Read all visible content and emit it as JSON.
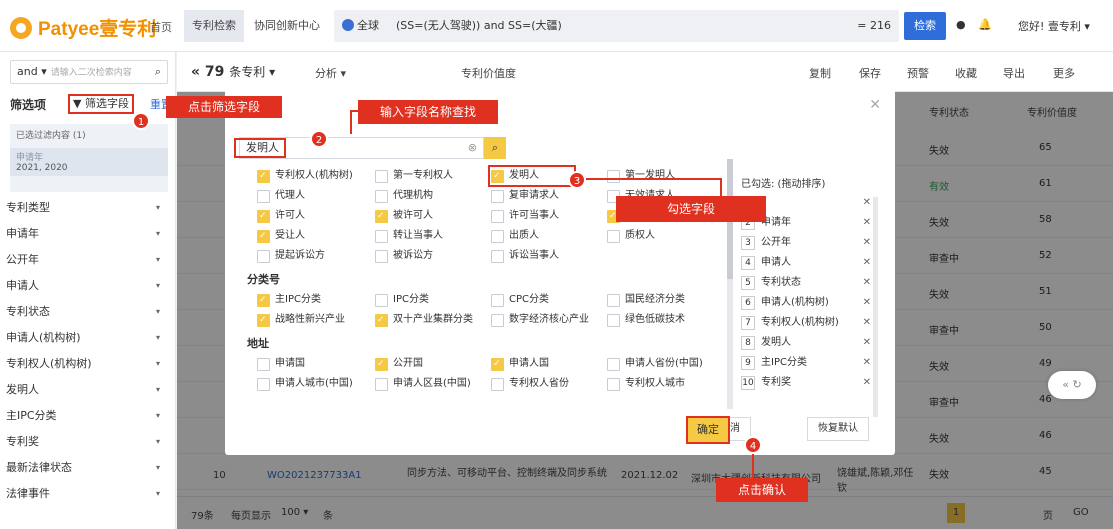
{
  "header": {
    "logo": "Patyee壹专利",
    "home": "首页",
    "tabs": [
      "专利检索",
      "协同创新中心"
    ],
    "scope": "全球",
    "query": "(SS=(无人驾驶)) and SS=(大疆)",
    "count": "= 216",
    "search_btn": "检索",
    "user": "您好! 壹专利 ▾"
  },
  "left": {
    "mode": "and ▾",
    "placeholder": "请输入二次检索内容",
    "filter_title": "筛选项",
    "filter_btn": "筛选字段",
    "reset": "重置",
    "selected_title": "已选过滤内容 (1)",
    "tag_label": "申请年",
    "tag_value": "2021, 2020",
    "items": [
      "专利类型",
      "申请年",
      "公开年",
      "申请人",
      "专利状态",
      "申请人(机构树)",
      "专利权人(机构树)",
      "发明人",
      "主IPC分类",
      "专利奖",
      "最新法律状态",
      "法律事件"
    ]
  },
  "mainbar": {
    "count": "79",
    "unit": "条专利 ▾",
    "analysis": "分析 ▾",
    "value_sort": "专利价值度",
    "actions": [
      "复制",
      "保存",
      "预警",
      "收藏",
      "导出",
      "更多"
    ]
  },
  "dialog": {
    "search_value": "发明人",
    "groups": [
      {
        "title": "",
        "items": [
          [
            "专利权人(机构树)",
            true
          ],
          [
            "第一专利权人",
            false
          ],
          [
            "发明人",
            true
          ],
          [
            "第一发明人",
            false
          ],
          [
            "代理人",
            false
          ],
          [
            "代理机构",
            false
          ],
          [
            "复审请求人",
            false
          ],
          [
            "无效请求人",
            false
          ],
          [
            "许可人",
            true
          ],
          [
            "被许可人",
            true
          ],
          [
            "许可当事人",
            false
          ],
          [
            "",
            true
          ],
          [
            "受让人",
            true
          ],
          [
            "转让当事人",
            false
          ],
          [
            "出质人",
            false
          ],
          [
            "质权人",
            false
          ],
          [
            "提起诉讼方",
            false
          ],
          [
            "被诉讼方",
            false
          ],
          [
            "诉讼当事人",
            false
          ]
        ]
      },
      {
        "title": "分类号",
        "items": [
          [
            "主IPC分类",
            true
          ],
          [
            "IPC分类",
            false
          ],
          [
            "CPC分类",
            false
          ],
          [
            "国民经济分类",
            false
          ],
          [
            "战略性新兴产业",
            true
          ],
          [
            "双十产业集群分类",
            true
          ],
          [
            "数字经济核心产业",
            false
          ],
          [
            "绿色低碳技术",
            false
          ]
        ]
      },
      {
        "title": "地址",
        "items": [
          [
            "申请国",
            false
          ],
          [
            "公开国",
            true
          ],
          [
            "申请人国",
            true
          ],
          [
            "申请人省份(中国)",
            false
          ],
          [
            "申请人城市(中国)",
            false
          ],
          [
            "申请人区县(中国)",
            false
          ],
          [
            "专利权人省份",
            false
          ],
          [
            "专利权人城市",
            false
          ]
        ]
      }
    ],
    "selected_title": "已勾选: (拖动排序)",
    "selected": [
      "",
      "申请年",
      "公开年",
      "申请人",
      "专利状态",
      "申请人(机构树)",
      "专利权人(机构树)",
      "发明人",
      "主IPC分类",
      "专利奖"
    ],
    "btn_ok": "确定",
    "btn_cancel": "取消",
    "btn_reset": "恢复默认"
  },
  "callouts": {
    "c1": "点击筛选字段",
    "c2": "输入字段名称查找",
    "c3": "勾选字段",
    "c4": "点击确认"
  },
  "table": {
    "col_status": "专利状态",
    "col_value": "专利价值度",
    "rows": [
      [
        "失效",
        "65"
      ],
      [
        "有效",
        "61"
      ],
      [
        "失效",
        "58"
      ],
      [
        "审查中",
        "52"
      ],
      [
        "失效",
        "51"
      ],
      [
        "审查中",
        "50"
      ],
      [
        "失效",
        "49"
      ],
      [
        "审查中",
        "46"
      ],
      [
        "失效",
        "46"
      ],
      [
        "失效",
        "45"
      ]
    ],
    "row10": {
      "idx": "10",
      "pn": "WO2021237733A1",
      "title": "同步方法、可移动平台、控制终端及同步系统",
      "date": "2021.12.02",
      "applicant": "深圳市大疆创新科技有限公司",
      "inventor": "饶雄斌,陈颖,邓任钦"
    }
  },
  "footer": {
    "total": "79条",
    "per_page": "每页显示",
    "size": "100 ▾",
    "unit": "条",
    "page": "1",
    "goto_unit": "页",
    "go": "GO"
  },
  "colors": {
    "accent": "#f6c945",
    "red": "#e03020",
    "blue": "#2f6ddb"
  }
}
